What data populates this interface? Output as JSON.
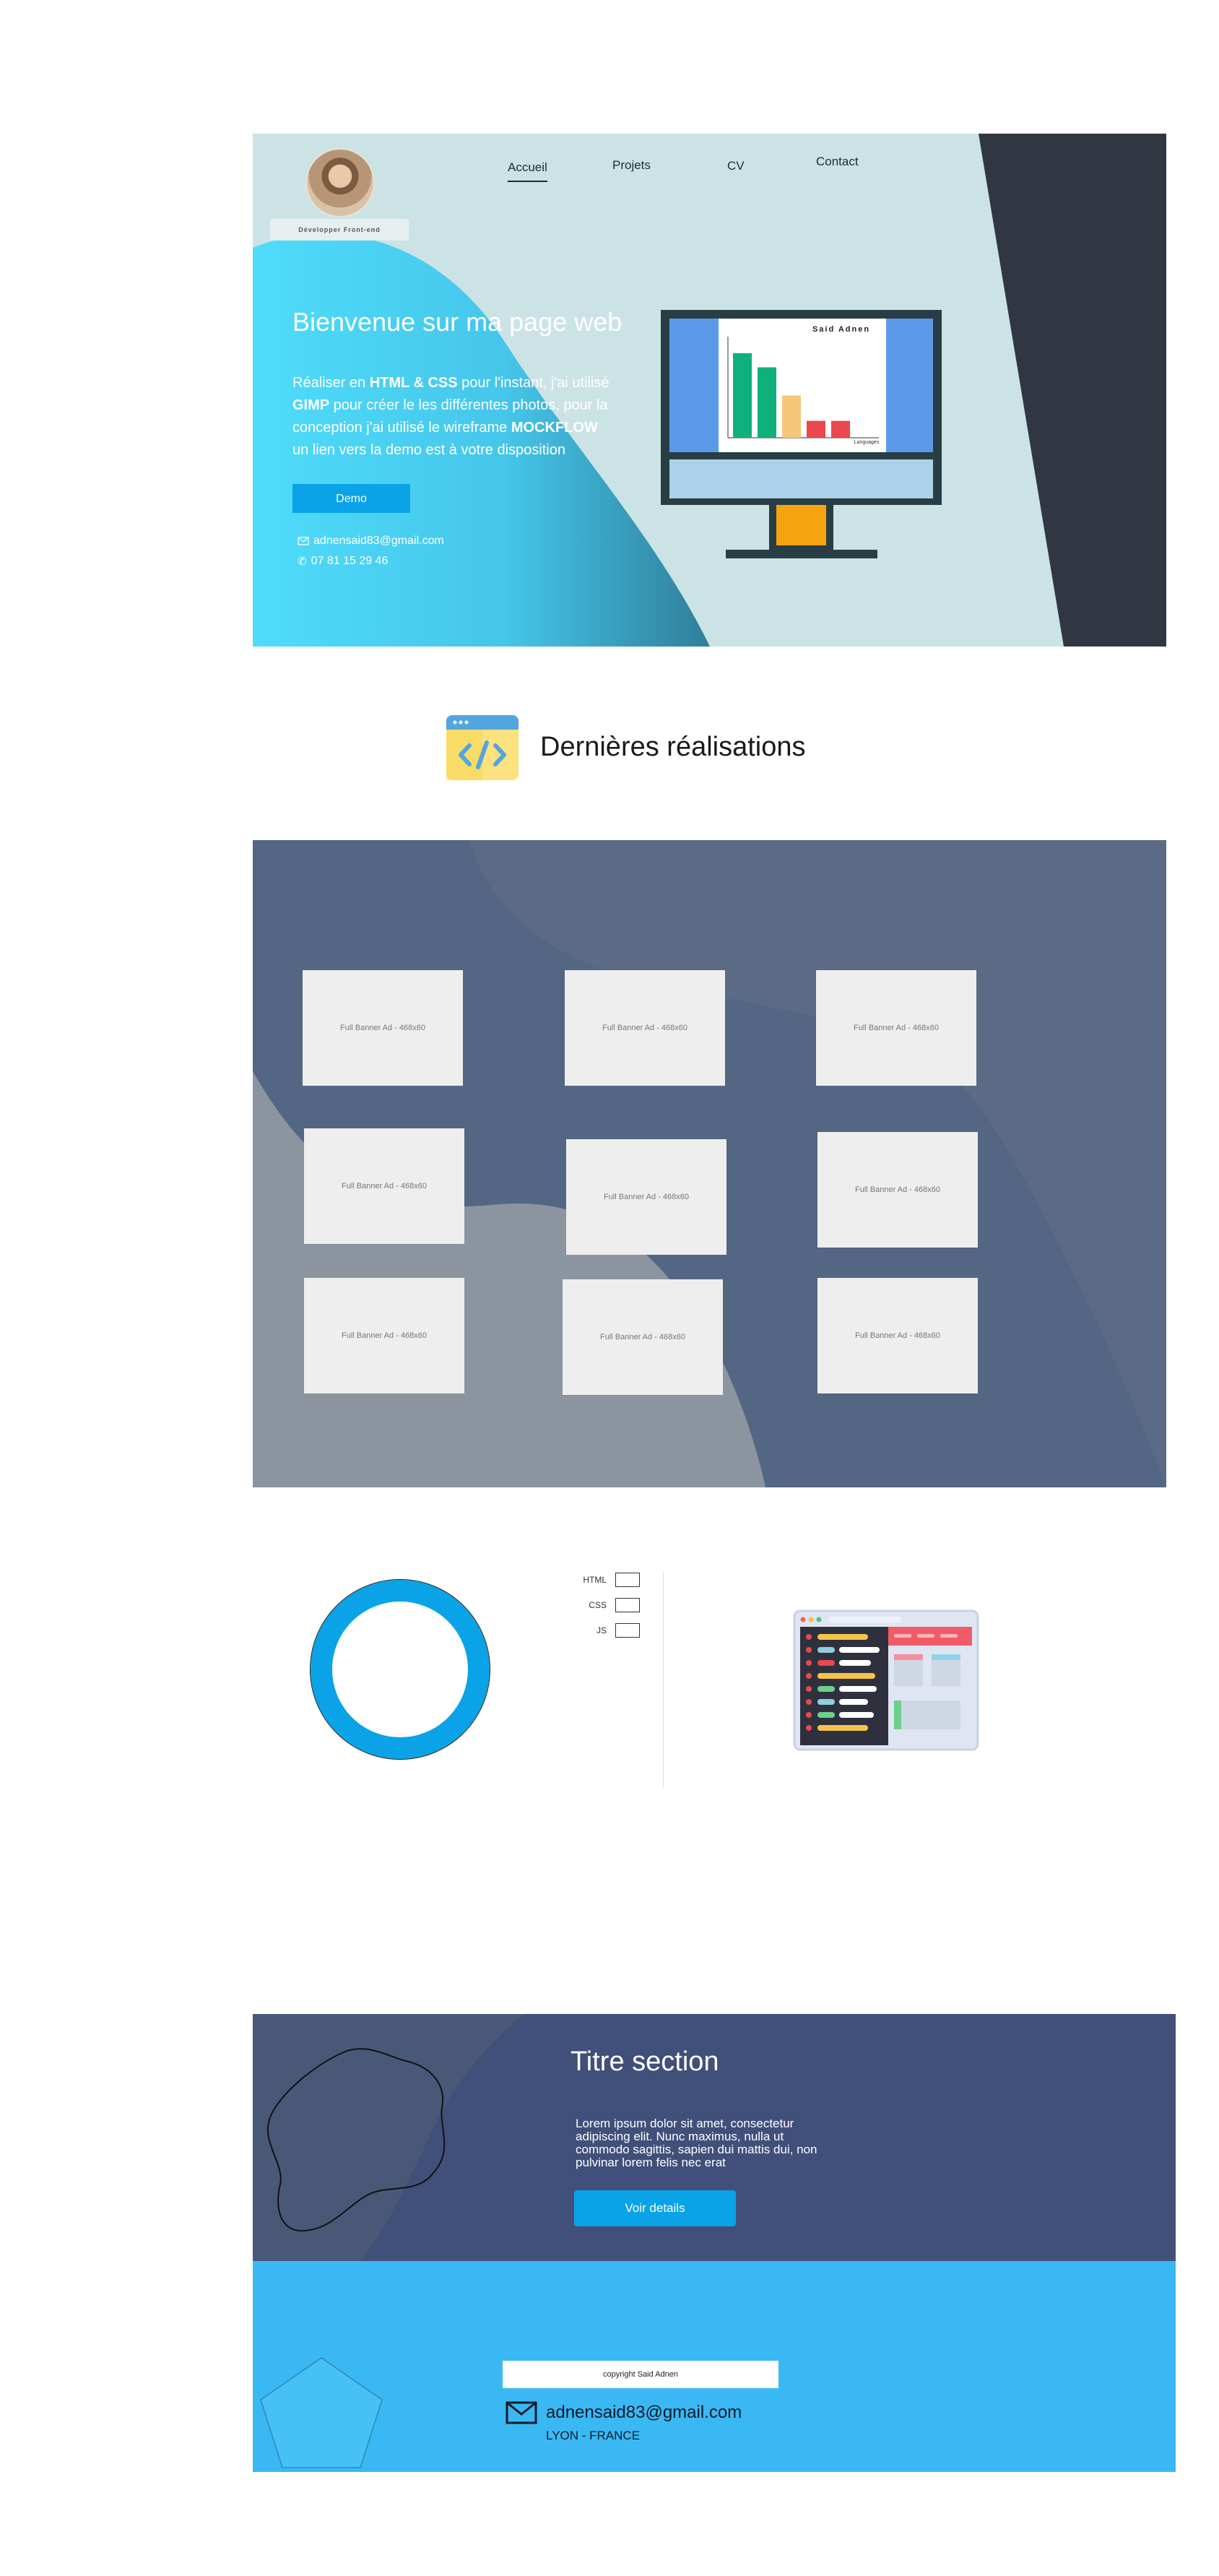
{
  "hero": {
    "role": "Développer Front-end",
    "nav": [
      "Accueil",
      "Projets",
      "CV",
      "Contact"
    ],
    "title": "Bienvenue sur ma page web",
    "intro": {
      "p1": "Réaliser en ",
      "b1": "HTML & CSS",
      "p2": " pour l'instant, j'ai utilisé ",
      "b2": "GIMP",
      "p3": " pour créer le les différentes photos, pour la conception j'ai utilisé le wireframe ",
      "b3": "MOCKFLOW",
      "p4": " un lien vers la demo est à votre disposition"
    },
    "demo_label": "Demo",
    "email": "adnensaid83@gmail.com",
    "phone": "07 81 15 29 46",
    "monitor": {
      "screen_title": "Said Adnen",
      "bar_values": [
        9,
        7.5,
        4.5,
        1.8,
        1.8
      ],
      "bar_colors": [
        "#10b07d",
        "#10b07d",
        "#f6c77a",
        "#e8484e",
        "#e8484e"
      ],
      "legend": "Languages"
    }
  },
  "section_heading": {
    "title": "Dernières réalisations",
    "icon": "code-window-icon"
  },
  "gallery": {
    "cards": [
      "Full Banner Ad - 468x60",
      "Full Banner Ad - 468x60",
      "Full Banner Ad - 468x60",
      "Full Banner Ad - 468x60",
      "Full Banner Ad - 468x60",
      "Full Banner Ad - 468x60",
      "Full Banner Ad - 468x60",
      "Full Banner Ad - 468x60",
      "Full Banner Ad - 468x60"
    ]
  },
  "skills": {
    "labels": [
      "HTML",
      "CSS",
      "JS"
    ]
  },
  "section4": {
    "title": "Titre section",
    "text": "Lorem ipsum dolor sit amet, consectetur adipiscing elit. Nunc maximus, nulla ut commodo sagittis, sapien dui mattis dui, non pulvinar lorem felis nec erat",
    "button": "Voir details"
  },
  "footer": {
    "copyright": "copyright Said Adnen",
    "email": "adnensaid83@gmail.com",
    "city": "LYON - FRANCE"
  },
  "colors": {
    "accent": "#0aa3e8",
    "dark": "#313643",
    "hero_bg": "#cce3e6",
    "gallery_bg": "#536683",
    "section4_bg": "#41507a",
    "footer_bg": "#3ab8f4"
  }
}
